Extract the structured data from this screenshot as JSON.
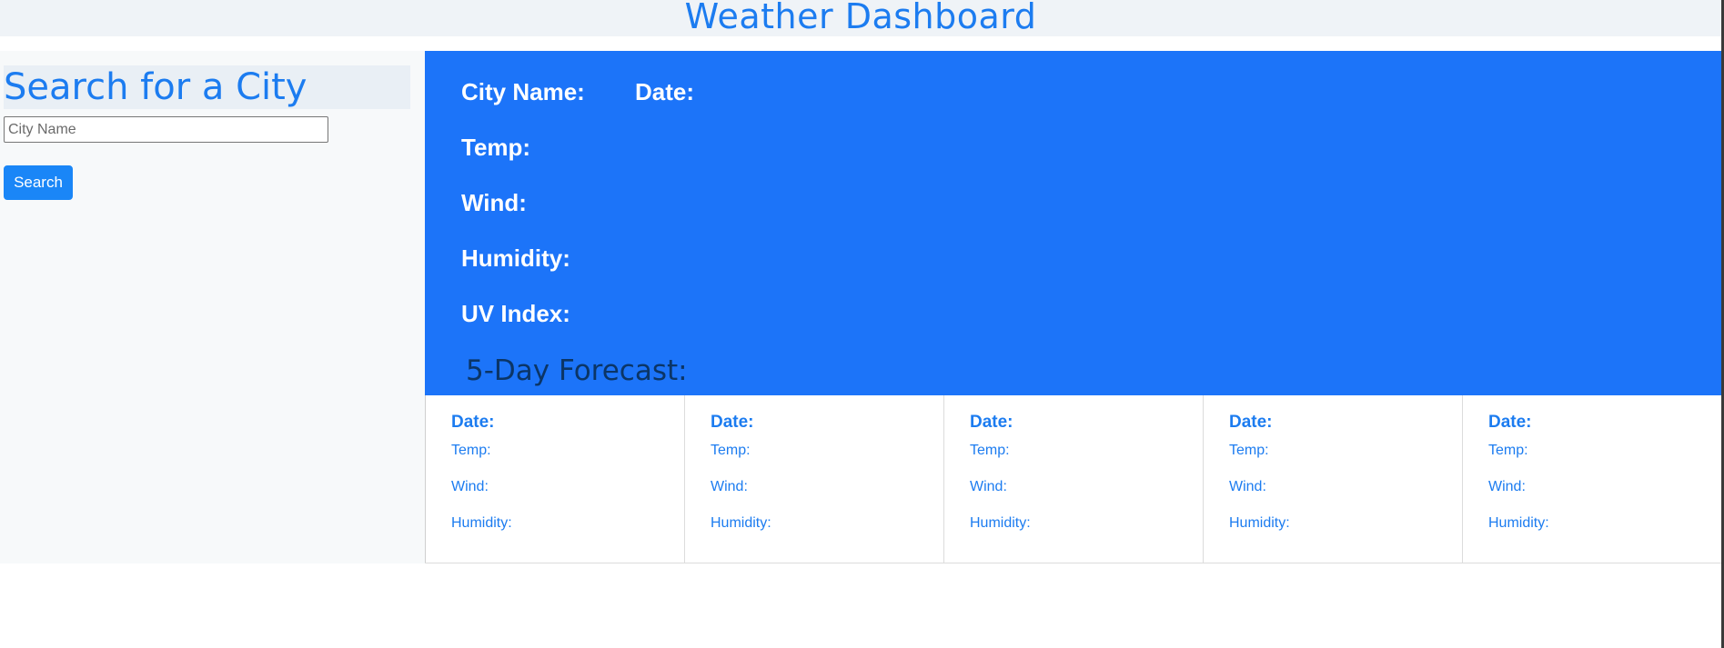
{
  "header": {
    "title": "Weather Dashboard"
  },
  "sidebar": {
    "title": "Search for a City",
    "search_input": {
      "placeholder": "City Name",
      "value": ""
    },
    "search_button_label": "Search"
  },
  "current": {
    "city_label": "City Name:",
    "city_value": "",
    "date_label": "Date:",
    "date_value": "",
    "temp_label": "Temp:",
    "temp_value": "",
    "wind_label": "Wind:",
    "wind_value": "",
    "humidity_label": "Humidity:",
    "humidity_value": "",
    "uv_label": "UV Index:",
    "uv_value": ""
  },
  "forecast": {
    "heading": "5-Day Forecast:",
    "days": [
      {
        "date_label": "Date:",
        "date": "",
        "temp_label": "Temp:",
        "temp": "",
        "wind_label": "Wind:",
        "wind": "",
        "humidity_label": "Humidity:",
        "humidity": ""
      },
      {
        "date_label": "Date:",
        "date": "",
        "temp_label": "Temp:",
        "temp": "",
        "wind_label": "Wind:",
        "wind": "",
        "humidity_label": "Humidity:",
        "humidity": ""
      },
      {
        "date_label": "Date:",
        "date": "",
        "temp_label": "Temp:",
        "temp": "",
        "wind_label": "Wind:",
        "wind": "",
        "humidity_label": "Humidity:",
        "humidity": ""
      },
      {
        "date_label": "Date:",
        "date": "",
        "temp_label": "Temp:",
        "temp": "",
        "wind_label": "Wind:",
        "wind": "",
        "humidity_label": "Humidity:",
        "humidity": ""
      },
      {
        "date_label": "Date:",
        "date": "",
        "temp_label": "Temp:",
        "temp": "",
        "wind_label": "Wind:",
        "wind": "",
        "humidity_label": "Humidity:",
        "humidity": ""
      }
    ]
  },
  "colors": {
    "accent": "#1c7cf0",
    "current_panel": "#1c74f9",
    "button": "#1a86f7",
    "forecast_heading": "#0b3566"
  }
}
